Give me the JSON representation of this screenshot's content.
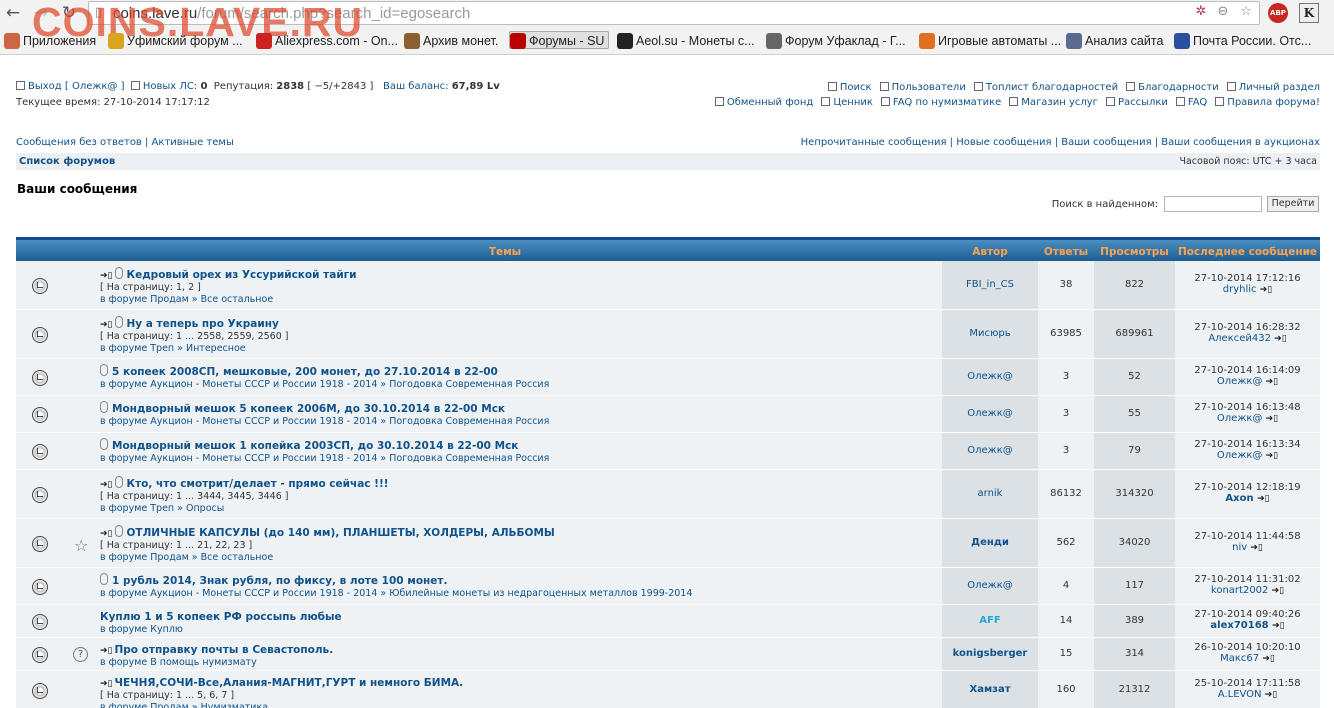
{
  "browser": {
    "url_host": "coins.lave.ru",
    "url_path": "/forum/search.php?search_id=egosearch",
    "watermark": "COINS.LAVE.RU",
    "abp_label": "ABP",
    "ext_k_label": "K",
    "bookmarks": [
      {
        "label": "Приложения",
        "icon": "apps-grid-icon",
        "color": "#c64"
      },
      {
        "label": "Уфимский форум ...",
        "icon": "globe-icon",
        "color": "#d9a520"
      },
      {
        "label": "Aliexpress.com - On...",
        "icon": "shopping-bag-icon",
        "color": "#c22"
      },
      {
        "label": "Архив монет.",
        "icon": "coin-icon",
        "color": "#8a6030"
      },
      {
        "label": "Форумы - SU",
        "icon": "letter-a-icon",
        "color": "#b00"
      },
      {
        "label": "Aeol.su - Монеты с...",
        "icon": "letter-a-icon",
        "color": "#222"
      },
      {
        "label": "Форум Уфаклад - Г...",
        "icon": "pickaxe-icon",
        "color": "#666"
      },
      {
        "label": "Игровые автоматы ...",
        "icon": "slot-icon",
        "color": "#e07020"
      },
      {
        "label": "Анализ сайта",
        "icon": "chart-icon",
        "color": "#5a6a90"
      },
      {
        "label": "Почта России. Отс...",
        "icon": "eagle-icon",
        "color": "#2a50a0"
      }
    ]
  },
  "header": {
    "logout": "Выход [ Олежк@ ]",
    "new_pm_label": "Новых ЛС:",
    "new_pm": "0",
    "rep_label": "Репутация:",
    "rep": "2838",
    "rep_detail": "[ −5/+2843 ]",
    "balance_label": "Ваш баланс:",
    "balance": "67,89 Lv",
    "time": "Текущее время: 27-10-2014 17:17:12",
    "links_row1": [
      "Поиск",
      "Пользователи",
      "Топлист благодарностей",
      "Благодарности",
      "Личный раздел"
    ],
    "links_row2": [
      "Обменный фонд",
      "Ценник",
      "FAQ по нумизматике",
      "Магазин услуг",
      "Рассылки",
      "FAQ",
      "Правила форума!"
    ],
    "left_links": "Сообщения без ответов | Активные темы",
    "right_links": "Непрочитанные сообщения | Новые сообщения | Ваши сообщения | Ваши сообщения в аукционах",
    "forum_list": "Список форумов",
    "timezone": "Часовой пояс: UTC + 3 часа"
  },
  "search": {
    "title": "Ваши сообщения",
    "label": "Поиск в найденном:",
    "value": "",
    "button": "Перейти"
  },
  "table": {
    "headers": [
      "Темы",
      "Автор",
      "Ответы",
      "Просмотры",
      "Последнее сообщение"
    ],
    "rows": [
      {
        "title": "Кедровый орех из Уссурийской тайги",
        "pages": "[ На страницу: 1, 2 ]",
        "forum": "в форуме Продам » Все остальное",
        "author": "FBI_in_CS",
        "author_bold": false,
        "author_color": "#105289",
        "replies": "38",
        "views": "822",
        "last_date": "27-10-2014 17:12:16",
        "last_author": "dryhlic",
        "last_bold": false,
        "last_color": "#105289",
        "goto": true,
        "attach": true,
        "extra": ""
      },
      {
        "title": "Ну а теперь про Украину",
        "pages": "[ На страницу: 1 ... 2558, 2559, 2560 ]",
        "forum": "в форуме Треп » Интересное",
        "author": "Мисюрь",
        "author_bold": false,
        "author_color": "#105289",
        "replies": "63985",
        "views": "689961",
        "last_date": "27-10-2014 16:28:32",
        "last_author": "Алексей432",
        "last_bold": false,
        "last_color": "#105289",
        "goto": true,
        "attach": true,
        "extra": ""
      },
      {
        "title": "5 копеек 2008СП, мешковые, 200 монет, до 27.10.2014 в 22-00",
        "pages": "",
        "forum": "в форуме Аукцион - Монеты СССР и России 1918 - 2014 » Погодовка Современная Россия",
        "author": "Олежк@",
        "author_bold": false,
        "author_color": "#105289",
        "replies": "3",
        "views": "52",
        "last_date": "27-10-2014 16:14:09",
        "last_author": "Олежк@",
        "last_bold": false,
        "last_color": "#105289",
        "goto": false,
        "attach": true,
        "extra": ""
      },
      {
        "title": "Мондворный мешок 5 копеек 2006М, до 30.10.2014 в 22-00 Мск",
        "pages": "",
        "forum": "в форуме Аукцион - Монеты СССР и России 1918 - 2014 » Погодовка Современная Россия",
        "author": "Олежк@",
        "author_bold": false,
        "author_color": "#105289",
        "replies": "3",
        "views": "55",
        "last_date": "27-10-2014 16:13:48",
        "last_author": "Олежк@",
        "last_bold": false,
        "last_color": "#105289",
        "goto": false,
        "attach": true,
        "extra": ""
      },
      {
        "title": "Мондворный мешок 1 копейка 2003СП, до 30.10.2014 в 22-00 Мск",
        "pages": "",
        "forum": "в форуме Аукцион - Монеты СССР и России 1918 - 2014 » Погодовка Современная Россия",
        "author": "Олежк@",
        "author_bold": false,
        "author_color": "#105289",
        "replies": "3",
        "views": "79",
        "last_date": "27-10-2014 16:13:34",
        "last_author": "Олежк@",
        "last_bold": false,
        "last_color": "#105289",
        "goto": false,
        "attach": true,
        "extra": ""
      },
      {
        "title": "Кто, что смотрит/делает - прямо сейчас !!!",
        "pages": "[ На страницу: 1 ... 3444, 3445, 3446 ]",
        "forum": "в форуме Треп » Опросы",
        "author": "arnik",
        "author_bold": false,
        "author_color": "#105289",
        "replies": "86132",
        "views": "314320",
        "last_date": "27-10-2014 12:18:19",
        "last_author": "Axon",
        "last_bold": true,
        "last_color": "#105289",
        "goto": true,
        "attach": true,
        "extra": ""
      },
      {
        "title": "ОТЛИЧНЫЕ КАПСУЛЫ (до 140 мм), ПЛАНШЕТЫ, ХОЛДЕРЫ, АЛЬБОМЫ",
        "pages": "[ На страницу: 1 ... 21, 22, 23 ]",
        "forum": "в форуме Продам » Все остальное",
        "author": "Денди",
        "author_bold": true,
        "author_color": "#105289",
        "replies": "562",
        "views": "34020",
        "last_date": "27-10-2014 11:44:58",
        "last_author": "niv",
        "last_bold": false,
        "last_color": "#105289",
        "goto": true,
        "attach": true,
        "extra": "star"
      },
      {
        "title": "1 рубль 2014, Знак рубля, по фиксу, в лоте 100 монет.",
        "pages": "",
        "forum": "в форуме Аукцион - Монеты СССР и России 1918 - 2014 » Юбилейные монеты из недрагоценных металлов 1999-2014",
        "author": "Олежк@",
        "author_bold": false,
        "author_color": "#105289",
        "replies": "4",
        "views": "117",
        "last_date": "27-10-2014 11:31:02",
        "last_author": "konart2002",
        "last_bold": false,
        "last_color": "#105289",
        "goto": false,
        "attach": true,
        "extra": ""
      },
      {
        "title": "Куплю 1 и 5 копеек РФ россыпь любые",
        "pages": "",
        "forum": "в форуме Куплю",
        "author": "AFF",
        "author_bold": true,
        "author_color": "#2aa6d6",
        "replies": "14",
        "views": "389",
        "last_date": "27-10-2014 09:40:26",
        "last_author": "alex70168",
        "last_bold": true,
        "last_color": "#105289",
        "goto": false,
        "attach": false,
        "extra": ""
      },
      {
        "title": "Про отправку почты в Севастополь.",
        "pages": "",
        "forum": "в форуме В помощь нумизмату",
        "author": "konigsberger",
        "author_bold": true,
        "author_color": "#105289",
        "replies": "15",
        "views": "314",
        "last_date": "26-10-2014 10:20:10",
        "last_author": "Макс67",
        "last_bold": false,
        "last_color": "#105289",
        "goto": true,
        "attach": false,
        "extra": "question"
      },
      {
        "title": "ЧЕЧНЯ,СОЧИ-Все,Алания-МАГНИТ,ГУРТ и немного БИМА.",
        "pages": "[ На страницу: 1 ... 5, 6, 7 ]",
        "forum": "в форуме Продам » Нумизматика",
        "author": "Хамзат",
        "author_bold": true,
        "author_color": "#105289",
        "replies": "160",
        "views": "21312",
        "last_date": "25-10-2014 17:11:58",
        "last_author": "A.LEVON",
        "last_bold": false,
        "last_color": "#105289",
        "goto": true,
        "attach": false,
        "extra": ""
      }
    ]
  }
}
